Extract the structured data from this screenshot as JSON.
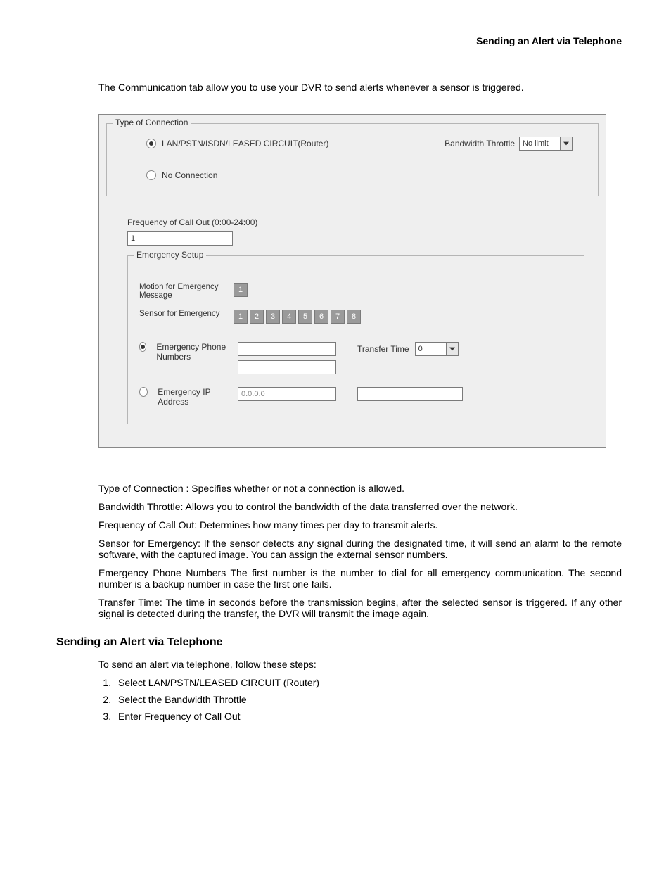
{
  "header": {
    "title": "Sending an Alert via Telephone"
  },
  "intro": "The Communication tab allow you to use your DVR to send alerts whenever a sensor is triggered.",
  "screenshot": {
    "type_of_connection": {
      "legend": "Type of Connection",
      "opt1": "LAN/PSTN/ISDN/LEASED CIRCUIT(Router)",
      "opt2": "No Connection",
      "bw_label": "Bandwidth Throttle",
      "bw_value": "No limit"
    },
    "frequency": {
      "label": "Frequency of Call Out (0:00-24:00)",
      "value": "1"
    },
    "emergency": {
      "legend": "Emergency Setup",
      "motion_label": "Motion for Emergency Message",
      "motion_boxes": [
        "1"
      ],
      "sensor_label": "Sensor for Emergency",
      "sensor_boxes": [
        "1",
        "2",
        "3",
        "4",
        "5",
        "6",
        "7",
        "8"
      ],
      "phone_label": "Emergency Phone Numbers",
      "phone1": "",
      "phone2": "",
      "transfer_label": "Transfer Time",
      "transfer_value": "0",
      "ip_label": "Emergency IP Address",
      "ip_value": "0.0.0.0",
      "ip_extra": ""
    }
  },
  "descriptions": {
    "p1": "Type of Connection : Specifies whether or not a connection is allowed.",
    "p2": "Bandwidth Throttle: Allows you to control the bandwidth of the data transferred over the network.",
    "p3": "Frequency of Call Out: Determines how many times per day to transmit alerts.",
    "p4": "Sensor for Emergency: If the sensor detects any signal during the designated time, it will send an alarm to the remote software, with the captured image. You can assign the external sensor numbers.",
    "p5": "Emergency Phone Numbers The first number is the number to dial for all emergency communication. The second number is a backup number in case the first one fails.",
    "p6": "Transfer Time: The time in seconds before the transmission begins, after the selected sensor is triggered. If any other signal is detected during the transfer, the DVR will transmit the image again."
  },
  "section": {
    "heading": "Sending an Alert via Telephone",
    "intro": "To send an alert via telephone, follow these steps:",
    "steps": [
      "Select LAN/PSTN/LEASED CIRCUIT (Router)",
      "Select the Bandwidth Throttle",
      "Enter Frequency of Call Out"
    ]
  }
}
